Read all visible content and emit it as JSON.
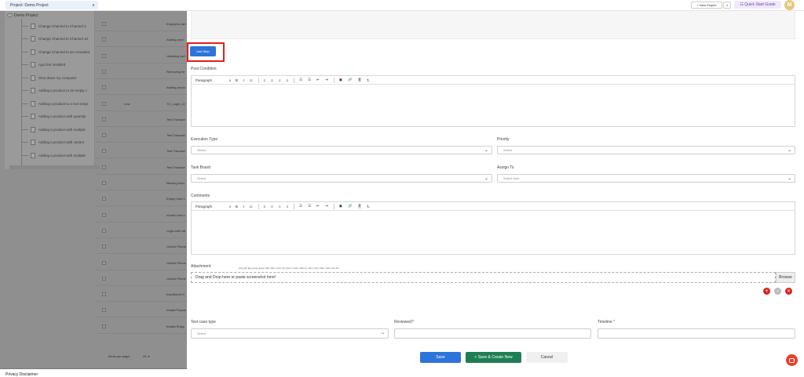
{
  "topbar": {
    "project_label": "Project:",
    "project_name": "Demo Project",
    "new_project": "+ New Project",
    "new_project_caret": "v",
    "quick_start": "Quick Start Guide",
    "avatar_initial": "M"
  },
  "tree": {
    "root": "Demo Project",
    "items": [
      "Change Channel to Channel 2",
      "Change Channel to Channel 10",
      "Change Channel to an Unavailat",
      "App first installed",
      "Shut down my computer",
      "Adding a product to an empty c",
      "Adding a product to a non-empt",
      "Adding a product with quantity",
      "Adding a product with multiple",
      "Adding a product with variant",
      "Adding a product with multiple"
    ]
  },
  "bg_table": {
    "rows": [
      {
        "link": "Empty/no cart"
      },
      {
        "link": "Adding prod"
      },
      {
        "link": "Updating cart"
      },
      {
        "link": "Removing ite"
      },
      {
        "link": "Adding produ"
      },
      {
        "link": "TC_Login_Cr",
        "extra": "Low"
      },
      {
        "link": "Test Transact"
      },
      {
        "link": "Test Transact"
      },
      {
        "link": "Test Transact"
      },
      {
        "link": "Test Transact"
      },
      {
        "link": "Missing User"
      },
      {
        "link": "Empty User L"
      },
      {
        "link": "Invalid User L"
      },
      {
        "link": "Login with val"
      },
      {
        "link": "Unlock Phone"
      },
      {
        "link": "Unlock Phone"
      },
      {
        "link": "Unlock Phone"
      },
      {
        "link": "Insufficient S"
      },
      {
        "link": "Invalid Payme"
      },
      {
        "link": "Invalid Shipp"
      }
    ],
    "items_per_page_label": "Items per page:",
    "items_per_page_value": "20"
  },
  "footer": {
    "privacy": "Privacy Disclaimer"
  },
  "form": {
    "add_step": "Add Step",
    "post_condition_label": "Post Condition",
    "toolbar": {
      "paragraph": "Paragraph",
      "chevron": "v",
      "bold": "B",
      "italic": "I",
      "underline": "U",
      "align_left": "≡",
      "align_center": "≡",
      "align_right": "≡",
      "justify": "≡",
      "bullet_list": "☰",
      "numbered_list": "☰",
      "outdent": "⇤",
      "indent": "⇥",
      "image": "▣",
      "link": "🔗",
      "source": "Ⅱ",
      "clear_format": "T̶"
    },
    "execution_type_label": "Execution Type",
    "execution_type_value": "Select",
    "priority_label": "Priority",
    "priority_value": "Select",
    "task_board_label": "Task Board",
    "task_board_value": "Select",
    "assign_to_label": "Assign To",
    "assign_to_value": "Select User",
    "comments_label": "Comments",
    "attachment_label": "Attachment",
    "attachment_types": "only gif | jpg | png | jpeg | pdf | xlsx | csv | xls | json | mp4 | webm | mkv | mov | flac | wav | ts | avi",
    "dropzone_text": "Drag and Drop here or paste screenshot here!",
    "browse": "Browse",
    "test_case_type_label": "Test case type",
    "test_case_type_value": "Select",
    "reviewed_label": "Reviewed?",
    "timeline_label": "Timeline",
    "required_mark": "*",
    "save": "Save",
    "save_create_new": "+ Save & Create New",
    "cancel": "Cancel"
  },
  "colors": {
    "primary": "#2d74da",
    "success": "#1e7f55",
    "danger": "#e0201a",
    "overlay": "#8f8f8f"
  }
}
